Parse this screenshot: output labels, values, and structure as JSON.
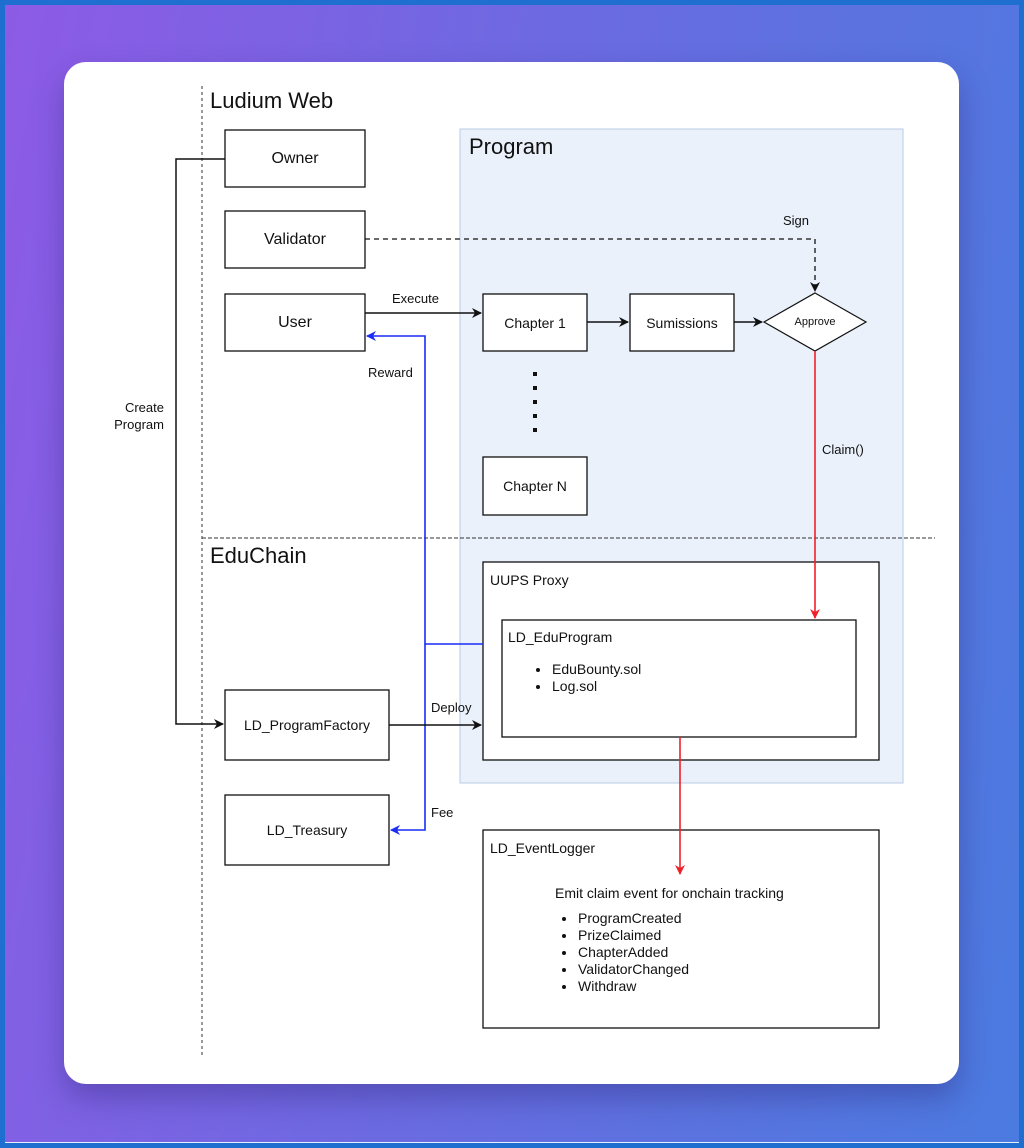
{
  "sections": {
    "web": "Ludium Web",
    "chain": "EduChain",
    "program": "Program"
  },
  "actors": {
    "owner": "Owner",
    "validator": "Validator",
    "user": "User"
  },
  "program_flow": {
    "chapter1": "Chapter 1",
    "submissions": "Sumissions",
    "approve": "Approve",
    "chapterN": "Chapter N"
  },
  "edges": {
    "execute": "Execute",
    "reward": "Reward",
    "sign": "Sign",
    "claim": "Claim()",
    "create_program": [
      "Create",
      "Program"
    ],
    "deploy": "Deploy",
    "fee": "Fee"
  },
  "contracts": {
    "factory": "LD_ProgramFactory",
    "treasury": "LD_Treasury",
    "proxy": "UUPS Proxy",
    "edu_program": {
      "title": "LD_EduProgram",
      "files": [
        "EduBounty.sol",
        "Log.sol"
      ]
    },
    "event_logger": {
      "title": "LD_EventLogger",
      "description": "Emit claim event for onchain tracking",
      "events": [
        "ProgramCreated",
        "PrizeClaimed",
        "ChapterAdded",
        "ValidatorChanged",
        "Withdraw"
      ]
    }
  },
  "colors": {
    "reward_fee_line": "#1a2cf5",
    "claim_line": "#f0202a",
    "program_fill": "#eaf1fb",
    "program_border": "#b8cbe6"
  }
}
